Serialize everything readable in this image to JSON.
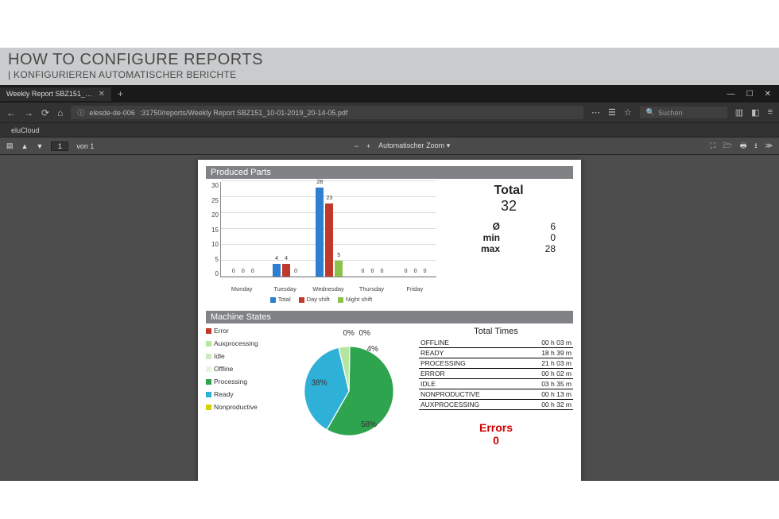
{
  "hero": {
    "title": "HOW TO CONFIGURE REPORTS",
    "subtitle": "| KONFIGURIEREN AUTOMATISCHER BERICHTE"
  },
  "browser": {
    "tab_title": "Weekly Report SBZ151_10-01-2019…",
    "url_host": "elesde-de-006",
    "url_path": ":31750/reports/Weekly Report SBZ151_10-01-2019_20-14-05.pdf",
    "search_placeholder": "Suchen",
    "bookmark": "eluCloud"
  },
  "pdf_toolbar": {
    "page": "1",
    "page_of": "von 1",
    "zoom_label": "Automatischer Zoom"
  },
  "report": {
    "produced_parts_title": "Produced Parts",
    "machine_states_title": "Machine States",
    "stats": {
      "total_label": "Total",
      "total_value": "32",
      "avg_symbol": "Ø",
      "avg_value": "6",
      "min_label": "min",
      "min_value": "0",
      "max_label": "max",
      "max_value": "28"
    },
    "legend": {
      "total": "Total",
      "day": "Day shift",
      "night": "Night shift"
    },
    "ms_legend": {
      "error": "Error",
      "aux": "Auxprocessing",
      "idle": "Idle",
      "offline": "Offline",
      "processing": "Processing",
      "ready": "Ready",
      "nonprod": "Nonproductive"
    },
    "total_times_title": "Total Times",
    "times": {
      "offline_k": "OFFLINE",
      "offline_v": "00 h 03 m",
      "ready_k": "READY",
      "ready_v": "18 h 39 m",
      "processing_k": "PROCESSING",
      "processing_v": "21 h 03 m",
      "error_k": "ERROR",
      "error_v": "00 h 02 m",
      "idle_k": "IDLE",
      "idle_v": "03 h 35 m",
      "nonprod_k": "NONPRODUCTIVE",
      "nonprod_v": "00 h 13 m",
      "aux_k": "AUXPROCESSING",
      "aux_v": "00 h 32 m"
    },
    "errors_label": "Errors",
    "errors_value": "0"
  },
  "chart_data": [
    {
      "type": "bar",
      "title": "Produced Parts",
      "categories": [
        "Monday",
        "Tuesday",
        "Wednesday",
        "Thursday",
        "Friday"
      ],
      "series": [
        {
          "name": "Total",
          "color": "#2f7fd1",
          "values": [
            0,
            4,
            28,
            0,
            0
          ]
        },
        {
          "name": "Day shift",
          "color": "#c0392b",
          "values": [
            0,
            4,
            23,
            0,
            0
          ]
        },
        {
          "name": "Night shift",
          "color": "#8bc34a",
          "values": [
            0,
            0,
            5,
            0,
            0
          ]
        }
      ],
      "ylabel": "",
      "xlabel": "",
      "ylim": [
        0,
        30
      ],
      "yticks": [
        0,
        5,
        10,
        15,
        20,
        25,
        30
      ]
    },
    {
      "type": "pie",
      "title": "Machine States",
      "slices": [
        {
          "name": "Processing",
          "value": 58,
          "color": "#2ea44f"
        },
        {
          "name": "Ready",
          "value": 38,
          "color": "#2fb0d6"
        },
        {
          "name": "Auxprocessing",
          "value": 4,
          "color": "#b5e6a1"
        },
        {
          "name": "Offline",
          "value": 0,
          "color": "#e6f5df"
        },
        {
          "name": "Idle",
          "value": 0,
          "color": "#cdeabf"
        },
        {
          "name": "Error",
          "value": 0,
          "color": "#c0392b"
        },
        {
          "name": "Nonproductive",
          "value": 0,
          "color": "#d4d200"
        }
      ],
      "label_suffix": "%"
    }
  ]
}
